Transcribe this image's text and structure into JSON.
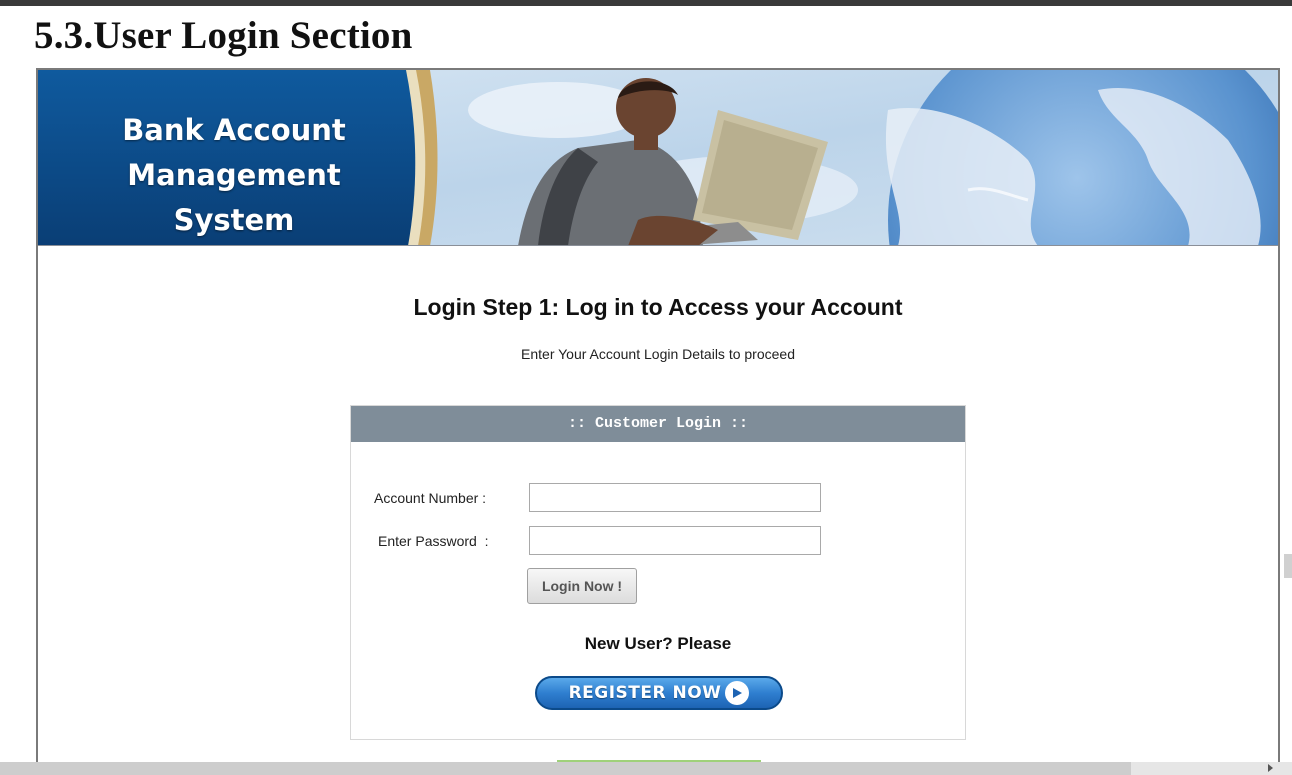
{
  "document": {
    "heading": "5.3.User Login Section"
  },
  "banner": {
    "title_line1": "Bank Account",
    "title_line2": "Management System"
  },
  "login": {
    "heading": "Login Step 1: Log in to Access your Account",
    "subheading": "Enter Your Account Login Details to proceed",
    "box_title": ":: Customer Login ::",
    "account_number_label": "Account Number :",
    "account_number_value": "",
    "password_label": "Enter Password  :",
    "password_value": "",
    "login_button": "Login Now !",
    "new_user_text": "New User? Please",
    "register_button": "REGISTER NOW"
  },
  "icons": {
    "register_arrow": "play-circle-icon"
  },
  "colors": {
    "banner_blue": "#0d4f8f",
    "box_header": "#7f8d99",
    "register_blue": "#2f7fd0"
  }
}
